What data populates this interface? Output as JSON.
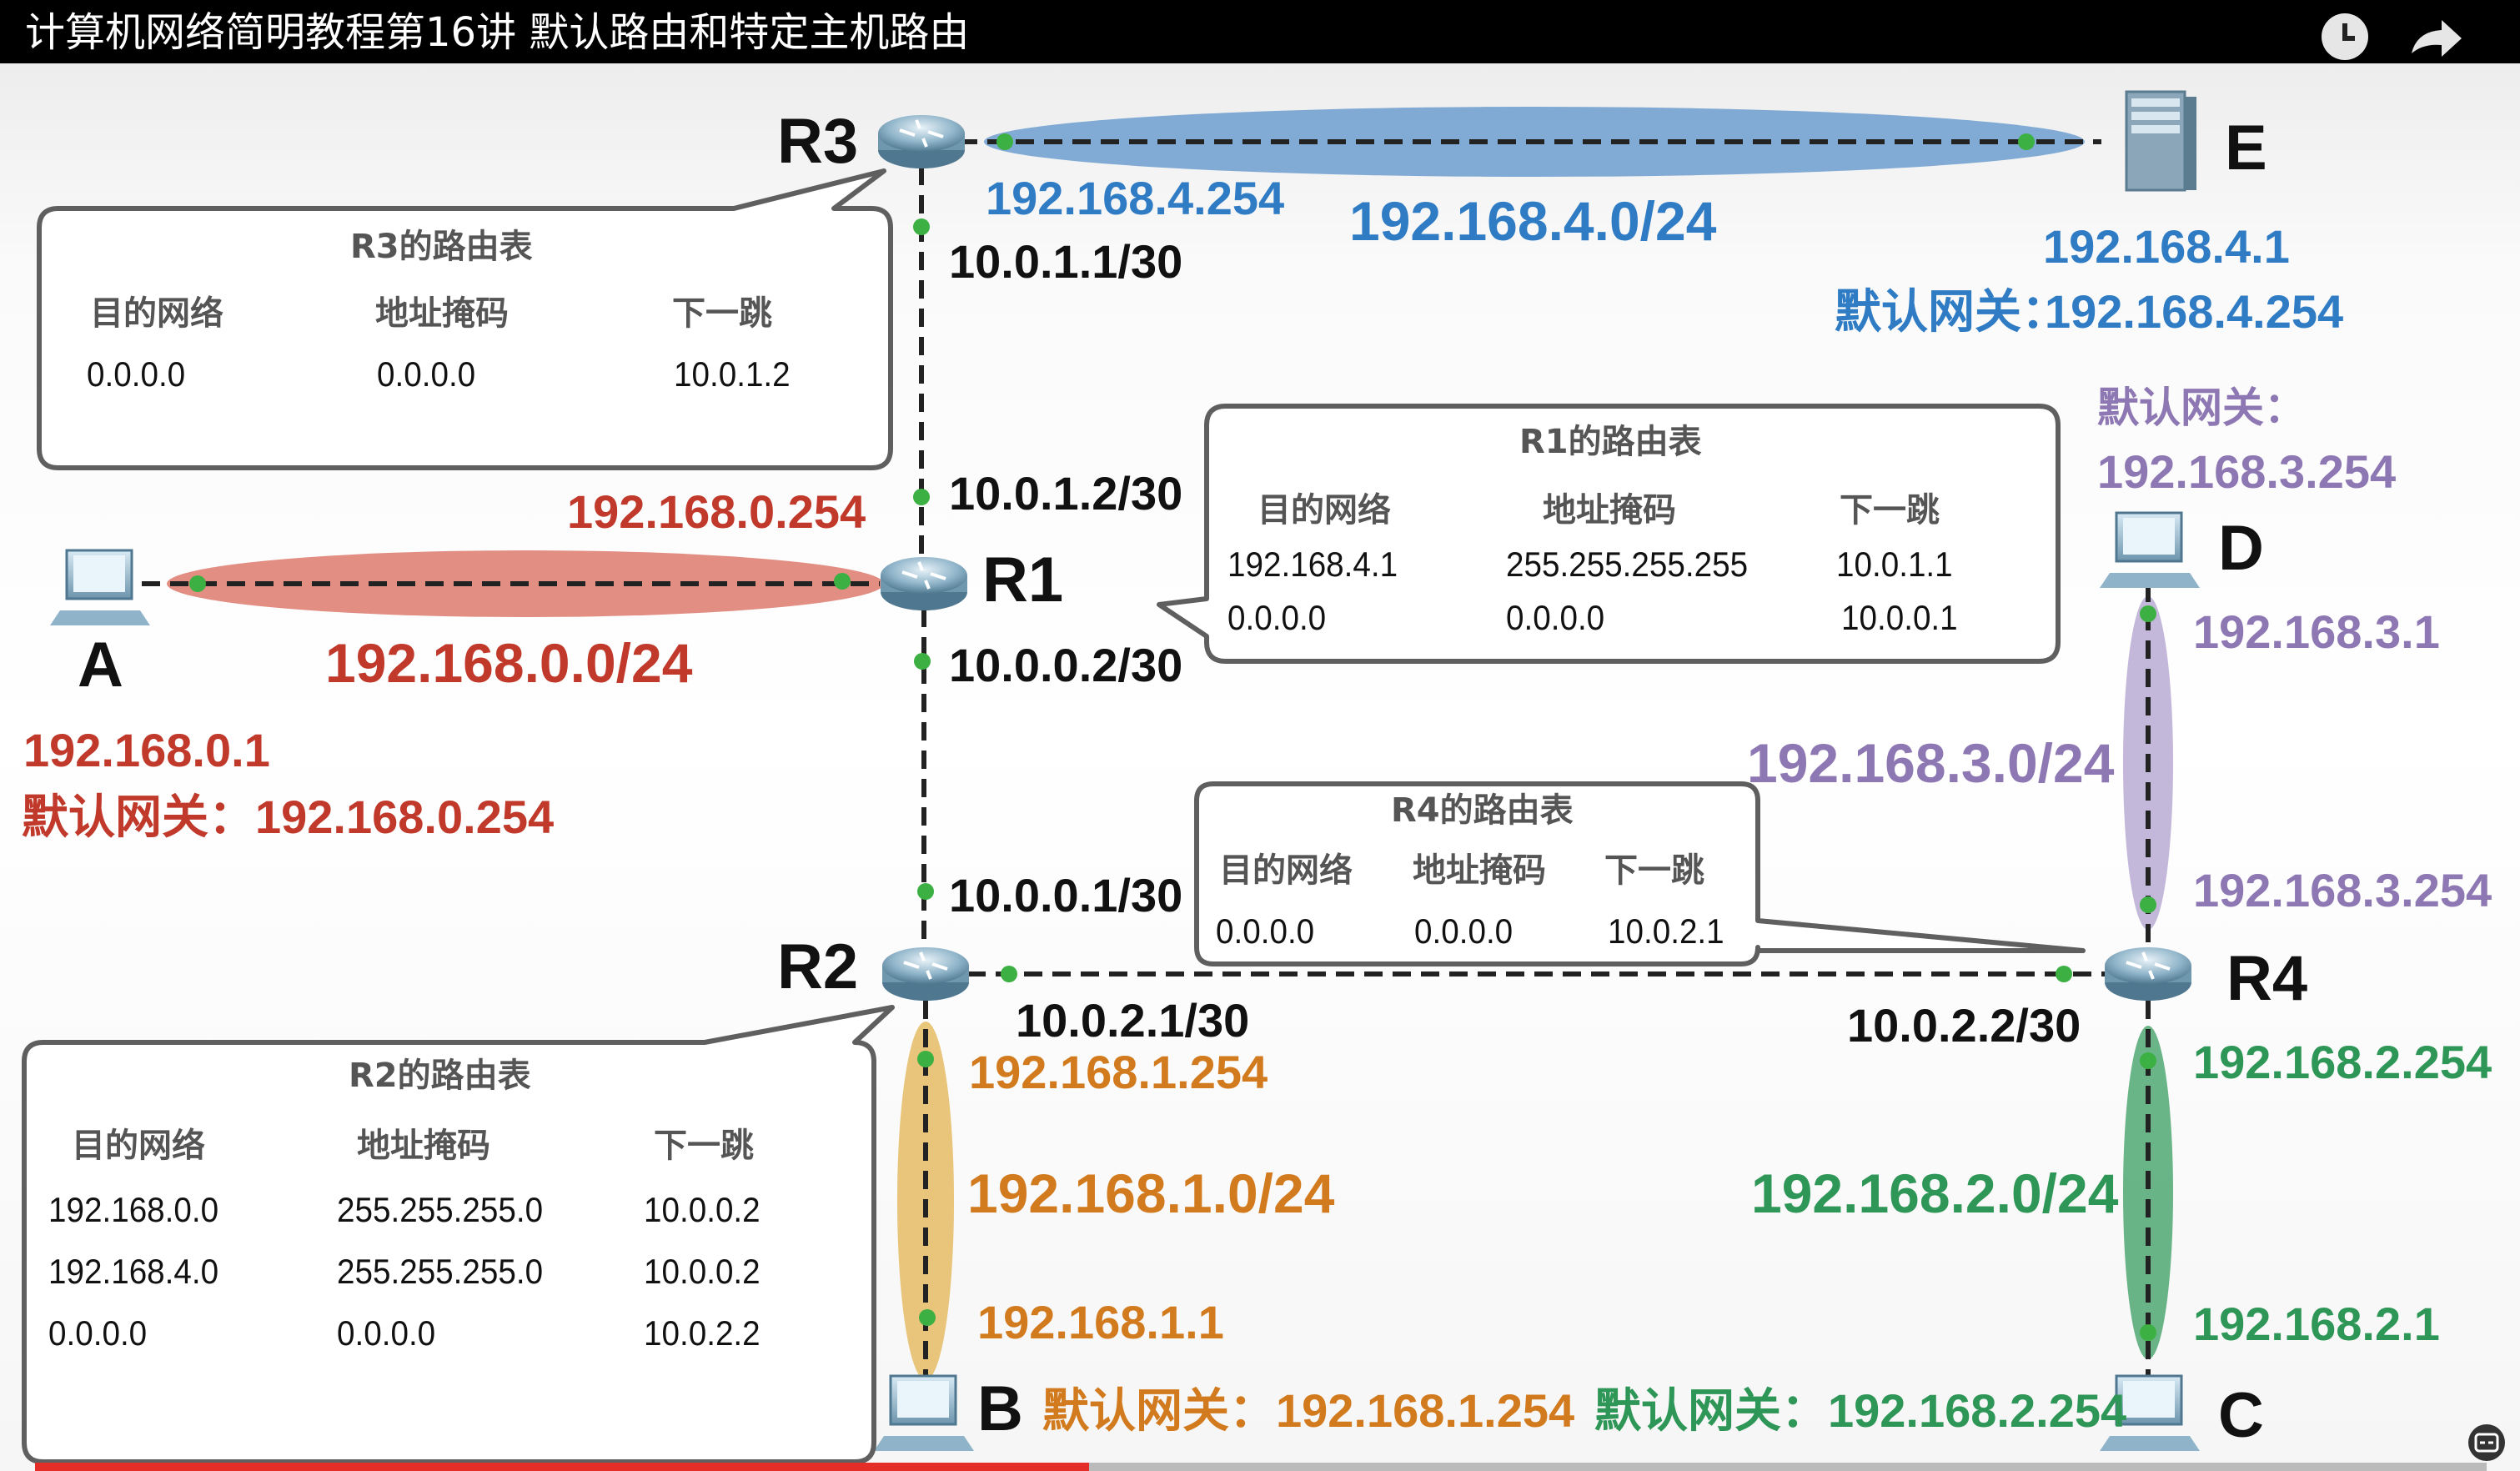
{
  "video": {
    "title": "计算机网络简明教程第16讲 默认路由和特定主机路由",
    "progress_fraction": 0.43,
    "icons": [
      "clock-icon",
      "share-icon",
      "caption-icon"
    ]
  },
  "nodes": {
    "R1": "R1",
    "R2": "R2",
    "R3": "R3",
    "R4": "R4",
    "A": "A",
    "B": "B",
    "C": "C",
    "D": "D",
    "E": "E"
  },
  "networks": {
    "net_0": "192.168.0.0/24",
    "net_1": "192.168.1.0/24",
    "net_2": "192.168.2.0/24",
    "net_3": "192.168.3.0/24",
    "net_4": "192.168.4.0/24"
  },
  "addresses": {
    "r3_lan": "192.168.4.254",
    "r3_wan": "10.0.1.1/30",
    "r1_up": "10.0.1.2/30",
    "r1_lan": "192.168.0.254",
    "r1_down": "10.0.0.2/30",
    "r2_up": "10.0.0.1/30",
    "r2_right": "10.0.2.1/30",
    "r2_lan": "192.168.1.254",
    "r4_left": "10.0.2.2/30",
    "r4_up": "192.168.3.254",
    "r4_down": "192.168.2.254",
    "a_ip": "192.168.0.1",
    "a_gw": "默认网关：192.168.0.254",
    "b_ip": "192.168.1.1",
    "b_gw": "默认网关：192.168.1.254",
    "c_ip": "192.168.2.1",
    "c_gw": "默认网关：192.168.2.254",
    "d_ip": "192.168.3.1",
    "d_gw_label": "默认网关：",
    "d_gw_value": "192.168.3.254",
    "e_ip": "192.168.4.1",
    "e_gw_label": "默认网关：",
    "e_gw_value": "192.168.4.254"
  },
  "headers": {
    "dest": "目的网络",
    "mask": "地址掩码",
    "next": "下一跳"
  },
  "tables": {
    "r3": {
      "title": "R3的路由表",
      "rows": [
        [
          "0.0.0.0",
          "0.0.0.0",
          "10.0.1.2"
        ]
      ]
    },
    "r1": {
      "title": "R1的路由表",
      "rows": [
        [
          "192.168.4.1",
          "255.255.255.255",
          "10.0.1.1"
        ],
        [
          "0.0.0.0",
          "0.0.0.0",
          "10.0.0.1"
        ]
      ]
    },
    "r4": {
      "title": "R4的路由表",
      "rows": [
        [
          "0.0.0.0",
          "0.0.0.0",
          "10.0.2.1"
        ]
      ]
    },
    "r2": {
      "title": "R2的路由表",
      "rows": [
        [
          "192.168.0.0",
          "255.255.255.0",
          "10.0.0.2"
        ],
        [
          "192.168.4.0",
          "255.255.255.0",
          "10.0.0.2"
        ],
        [
          "0.0.0.0",
          "0.0.0.0",
          "10.0.2.2"
        ]
      ]
    }
  },
  "colors": {
    "blue": "#2f7cc4",
    "red": "#c0392b",
    "purple": "#8e78b3",
    "orange": "#d27a1e",
    "green": "#2e9656",
    "link": "#222222",
    "port": "#3cb043"
  }
}
